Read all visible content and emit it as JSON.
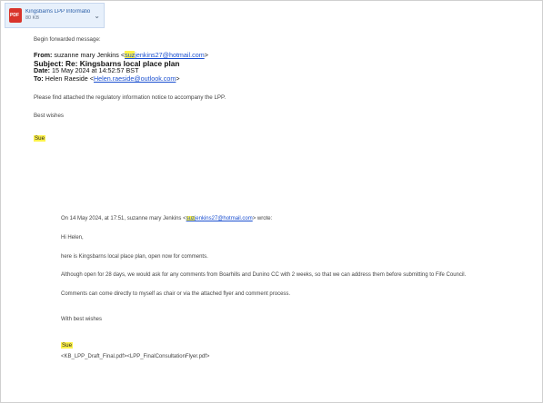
{
  "attachment": {
    "filename": "Kingsbarns LPP Information Notice.pdf",
    "size": "80 KB",
    "icon": "pdf-icon"
  },
  "email": {
    "intro": "Begin forwarded message:",
    "from_label": "From:",
    "from_name": "suzanne mary Jenkins <",
    "from_email_hl": "suz",
    "from_email_rest": "jenkins27@hotmail.com",
    "from_close": ">",
    "subject_label": "Subject:",
    "subject": "Re: Kingsbarns local place plan",
    "date_label": "Date:",
    "date": "15 May 2024 at 14:52:57 BST",
    "to_label": "To:",
    "to_name": "Helen Raeside <",
    "to_email": "Helen.raeside@outlook.com",
    "to_close": ">",
    "body_line": "Please find attached the regulatory information notice to accompany the LPP.",
    "closing": "Best wishes",
    "signature": "Sue"
  },
  "quoted": {
    "header_prefix": "On 14 May 2024, at 17:51, suzanne mary Jenkins <",
    "header_email_hl": "suz",
    "header_email_rest": "jenkins27@hotmail.com",
    "header_suffix": "> wrote:",
    "greeting": "Hi Helen,",
    "line1": "here is Kingsbarns local place plan, open now for comments.",
    "line2": "Although open for 28 days, we would ask for any comments from Boarhills and Dunino CC with 2 weeks, so that we can address them before submitting to Fife Council.",
    "line3": "Comments can come directly to myself as chair or via the attached flyer and comment process.",
    "closing": "With best wishes",
    "signature": "Sue",
    "attachment_line": "<KB_LPP_Draft_Final.pdf><LPP_FinalConsultationFlyer.pdf>"
  }
}
